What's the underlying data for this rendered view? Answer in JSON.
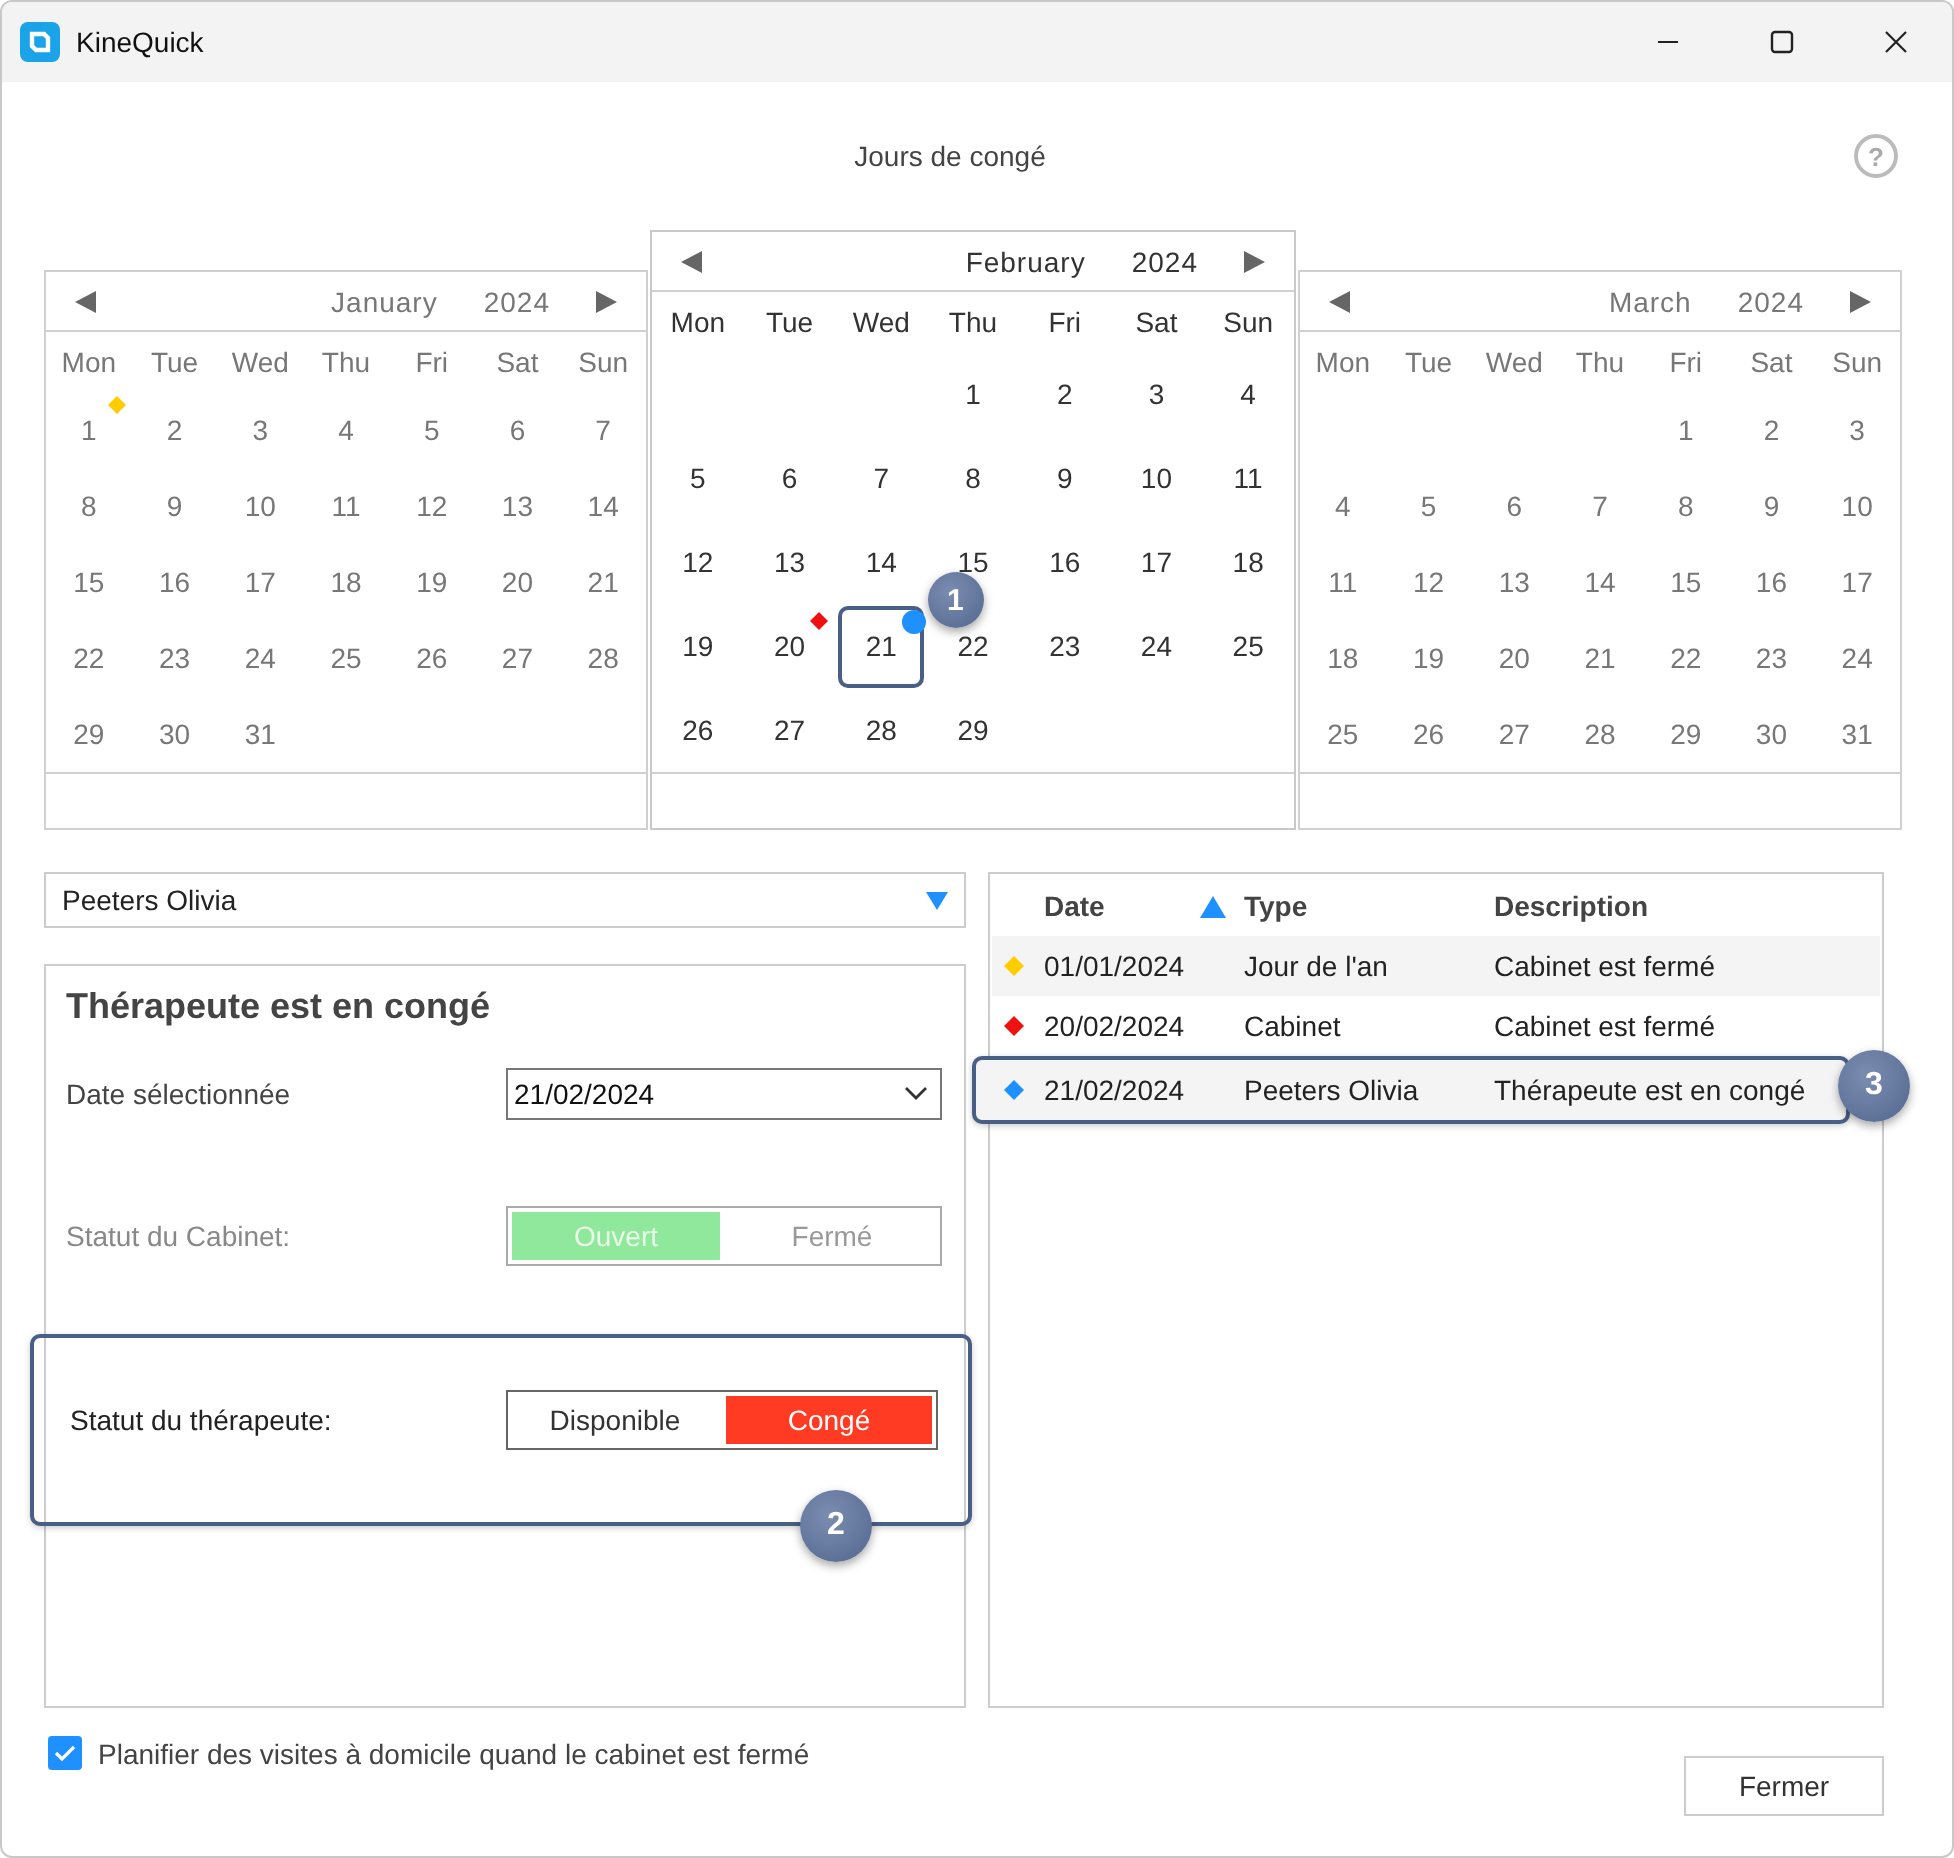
{
  "window": {
    "title": "KineQuick"
  },
  "dialog": {
    "title": "Jours de congé",
    "help": "?"
  },
  "calendars": [
    {
      "month": "January",
      "year": "2024",
      "focused": false,
      "weekdays": [
        "Mon",
        "Tue",
        "Wed",
        "Thu",
        "Fri",
        "Sat",
        "Sun"
      ],
      "weeks": [
        [
          {
            "day": "1",
            "selected": false,
            "marker": {
              "kind": "diamond",
              "color": "#ffcc00"
            }
          },
          {
            "day": "2",
            "selected": false
          },
          {
            "day": "3",
            "selected": false
          },
          {
            "day": "4",
            "selected": false
          },
          {
            "day": "5",
            "selected": false
          },
          {
            "day": "6",
            "selected": false
          },
          {
            "day": "7",
            "selected": false
          }
        ],
        [
          {
            "day": "8",
            "selected": false
          },
          {
            "day": "9",
            "selected": false
          },
          {
            "day": "10",
            "selected": false
          },
          {
            "day": "11",
            "selected": false
          },
          {
            "day": "12",
            "selected": false
          },
          {
            "day": "13",
            "selected": false
          },
          {
            "day": "14",
            "selected": false
          }
        ],
        [
          {
            "day": "15",
            "selected": false
          },
          {
            "day": "16",
            "selected": false
          },
          {
            "day": "17",
            "selected": false
          },
          {
            "day": "18",
            "selected": false
          },
          {
            "day": "19",
            "selected": false
          },
          {
            "day": "20",
            "selected": false
          },
          {
            "day": "21",
            "selected": false
          }
        ],
        [
          {
            "day": "22",
            "selected": false
          },
          {
            "day": "23",
            "selected": false
          },
          {
            "day": "24",
            "selected": false
          },
          {
            "day": "25",
            "selected": false
          },
          {
            "day": "26",
            "selected": false
          },
          {
            "day": "27",
            "selected": false
          },
          {
            "day": "28",
            "selected": false
          }
        ],
        [
          {
            "day": "29",
            "selected": false
          },
          {
            "day": "30",
            "selected": false
          },
          {
            "day": "31",
            "selected": false
          }
        ]
      ]
    },
    {
      "month": "February",
      "year": "2024",
      "focused": true,
      "weekdays": [
        "Mon",
        "Tue",
        "Wed",
        "Thu",
        "Fri",
        "Sat",
        "Sun"
      ],
      "weeks": [
        [
          {
            "day": "1",
            "selected": false
          },
          {
            "day": "2",
            "selected": false
          },
          {
            "day": "3",
            "selected": false
          },
          {
            "day": "4",
            "selected": false
          }
        ],
        [
          {
            "day": "5",
            "selected": false
          },
          {
            "day": "6",
            "selected": false
          },
          {
            "day": "7",
            "selected": false
          },
          {
            "day": "8",
            "selected": false
          },
          {
            "day": "9",
            "selected": false
          },
          {
            "day": "10",
            "selected": false
          },
          {
            "day": "11",
            "selected": false
          }
        ],
        [
          {
            "day": "12",
            "selected": false
          },
          {
            "day": "13",
            "selected": false
          },
          {
            "day": "14",
            "selected": false
          },
          {
            "day": "15",
            "selected": false
          },
          {
            "day": "16",
            "selected": false
          },
          {
            "day": "17",
            "selected": false
          },
          {
            "day": "18",
            "selected": false
          }
        ],
        [
          {
            "day": "19",
            "selected": false
          },
          {
            "day": "20",
            "selected": false,
            "marker": {
              "kind": "diamond",
              "color": "#ee1111"
            }
          },
          {
            "day": "21",
            "selected": true,
            "callout": "1",
            "marker": {
              "kind": "dot",
              "color": "#1e90ff"
            }
          },
          {
            "day": "22",
            "selected": false
          },
          {
            "day": "23",
            "selected": false
          },
          {
            "day": "24",
            "selected": false
          },
          {
            "day": "25",
            "selected": false
          }
        ],
        [
          {
            "day": "26",
            "selected": false
          },
          {
            "day": "27",
            "selected": false
          },
          {
            "day": "28",
            "selected": false
          },
          {
            "day": "29",
            "selected": false
          }
        ]
      ]
    },
    {
      "month": "March",
      "year": "2024",
      "focused": false,
      "weekdays": [
        "Mon",
        "Tue",
        "Wed",
        "Thu",
        "Fri",
        "Sat",
        "Sun"
      ],
      "weeks": [
        [
          {
            "day": "1",
            "selected": false
          },
          {
            "day": "2",
            "selected": false
          },
          {
            "day": "3",
            "selected": false
          }
        ],
        [
          {
            "day": "4",
            "selected": false
          },
          {
            "day": "5",
            "selected": false
          },
          {
            "day": "6",
            "selected": false
          },
          {
            "day": "7",
            "selected": false
          },
          {
            "day": "8",
            "selected": false
          },
          {
            "day": "9",
            "selected": false
          },
          {
            "day": "10",
            "selected": false
          }
        ],
        [
          {
            "day": "11",
            "selected": false
          },
          {
            "day": "12",
            "selected": false
          },
          {
            "day": "13",
            "selected": false
          },
          {
            "day": "14",
            "selected": false
          },
          {
            "day": "15",
            "selected": false
          },
          {
            "day": "16",
            "selected": false
          },
          {
            "day": "17",
            "selected": false
          }
        ],
        [
          {
            "day": "18",
            "selected": false
          },
          {
            "day": "19",
            "selected": false
          },
          {
            "day": "20",
            "selected": false
          },
          {
            "day": "21",
            "selected": false
          },
          {
            "day": "22",
            "selected": false
          },
          {
            "day": "23",
            "selected": false
          },
          {
            "day": "24",
            "selected": false
          }
        ],
        [
          {
            "day": "25",
            "selected": false
          },
          {
            "day": "26",
            "selected": false
          },
          {
            "day": "27",
            "selected": false
          },
          {
            "day": "28",
            "selected": false
          },
          {
            "day": "29",
            "selected": false
          },
          {
            "day": "30",
            "selected": false
          },
          {
            "day": "31",
            "selected": false
          }
        ]
      ]
    }
  ],
  "therapist_select": {
    "value": "Peeters Olivia"
  },
  "panel": {
    "title": "Thérapeute est en congé",
    "date": {
      "label": "Date sélectionnée",
      "value": "21/02/2024"
    },
    "statuses": [
      {
        "label": "Statut du Cabinet:",
        "disabled": true,
        "options": [
          {
            "label": "Ouvert",
            "selected": true,
            "color": "#90e89c"
          },
          {
            "label": "Fermé",
            "selected": false
          }
        ]
      },
      {
        "label": "Statut du thérapeute:",
        "disabled": false,
        "callout": "2",
        "options": [
          {
            "label": "Disponible",
            "selected": false
          },
          {
            "label": "Congé",
            "selected": true,
            "color": "#ff3b24"
          }
        ]
      }
    ]
  },
  "holidays": {
    "columns": [
      {
        "label": "Date",
        "sorted_ascending": true
      },
      {
        "label": "Type"
      },
      {
        "label": "Description"
      }
    ],
    "rows": [
      {
        "color": "#ffcc00",
        "date": "01/01/2024",
        "type": "Jour de l'an",
        "description": "Cabinet est fermé"
      },
      {
        "color": "#ee1111",
        "date": "20/02/2024",
        "type": "Cabinet",
        "description": "Cabinet est fermé"
      },
      {
        "color": "#1e90ff",
        "date": "21/02/2024",
        "type": "Peeters Olivia",
        "description": "Thérapeute est en congé",
        "callout": "3"
      }
    ]
  },
  "home_visits": {
    "label": "Planifier des visites à domicile quand le cabinet est fermé",
    "checked": true
  },
  "buttons": [
    "Fermer"
  ]
}
